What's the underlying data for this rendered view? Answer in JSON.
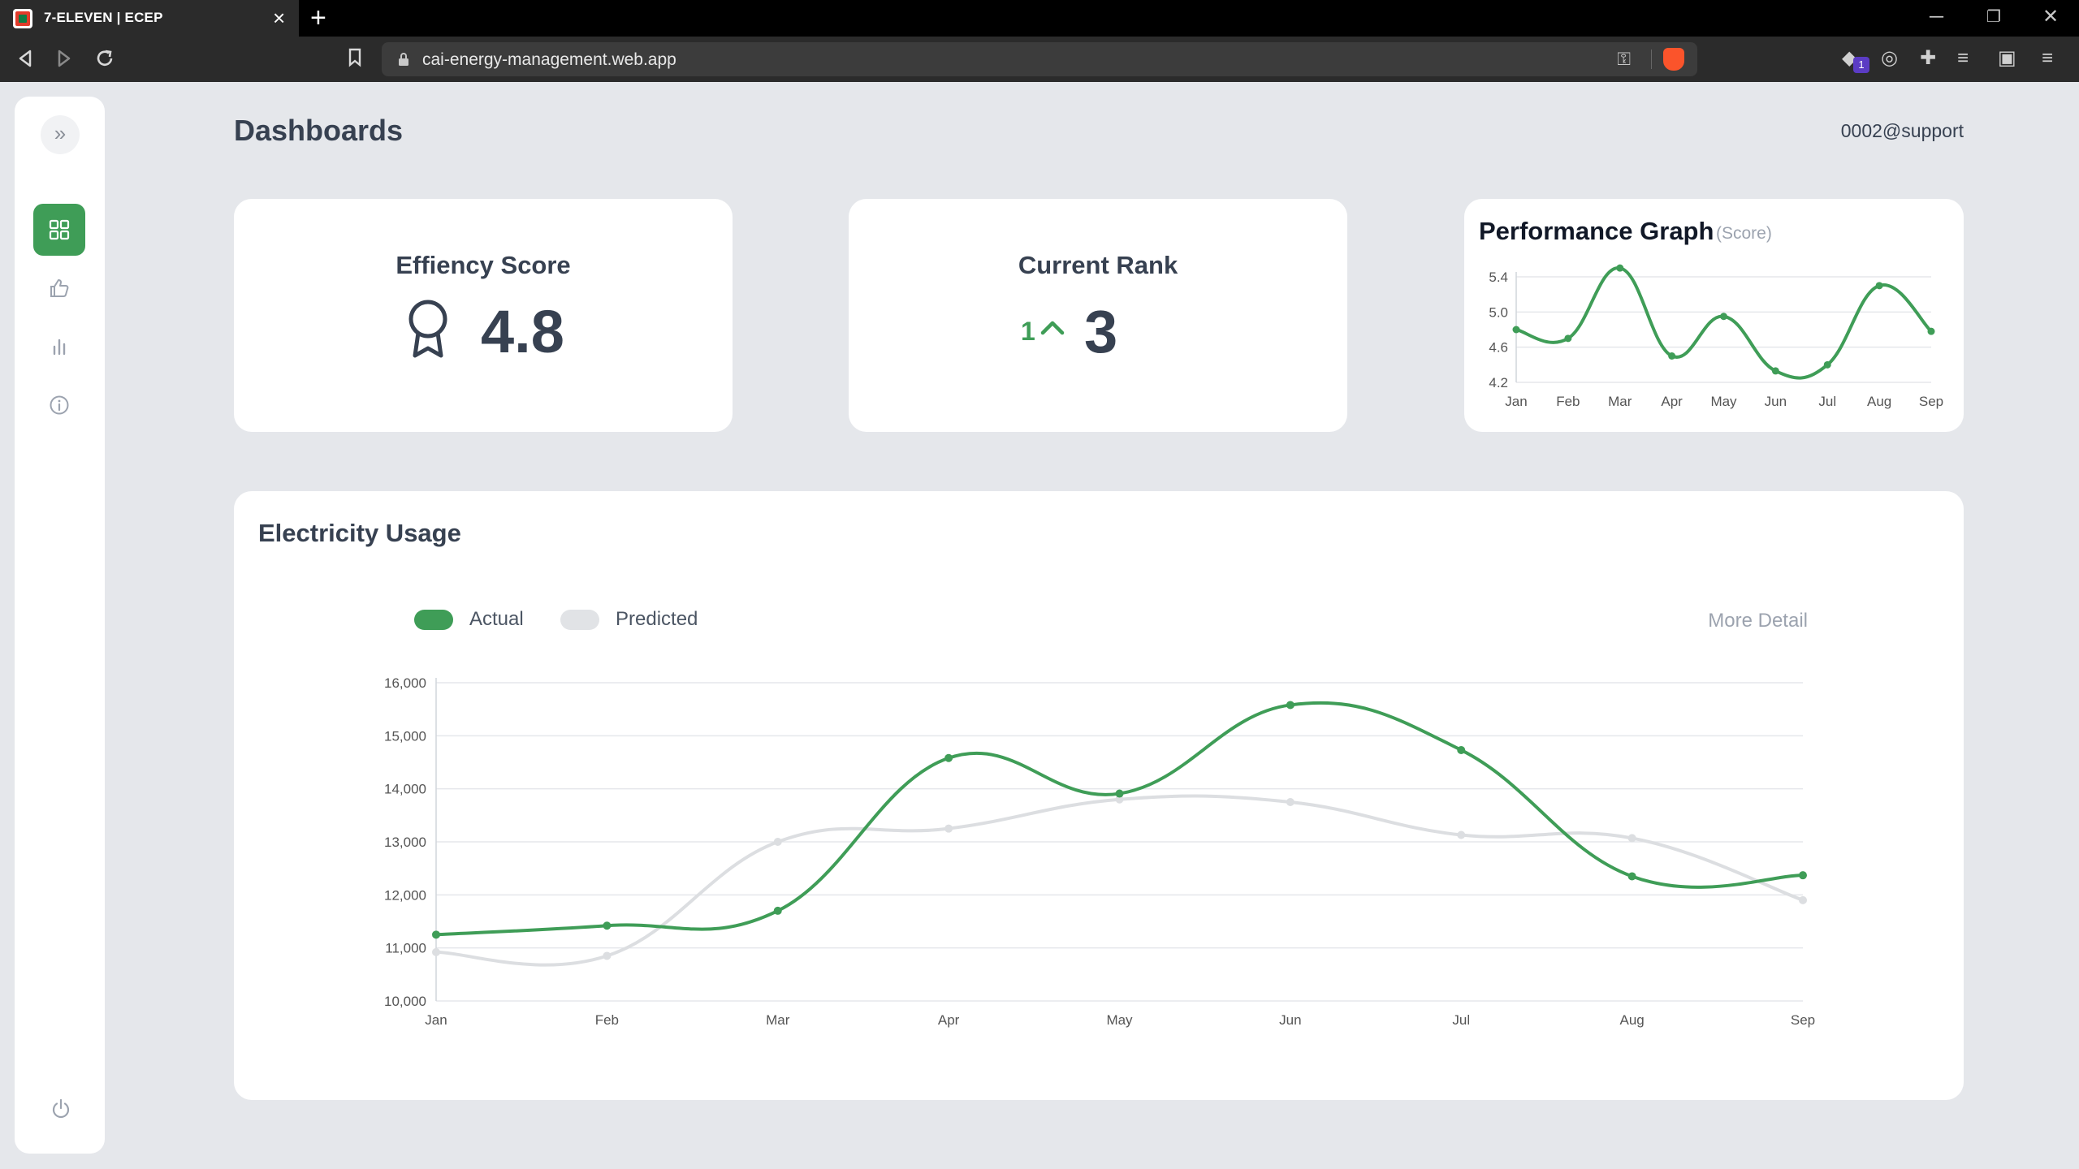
{
  "browser": {
    "tab_title": "7-ELEVEN | ECEP",
    "url": "cai-energy-management.web.app",
    "extension_badge": "1"
  },
  "sidebar": {
    "items": [
      {
        "icon": "dashboard-grid-icon",
        "active": true
      },
      {
        "icon": "thumbs-up-icon",
        "active": false
      },
      {
        "icon": "bar-chart-icon",
        "active": false
      },
      {
        "icon": "info-icon",
        "active": false
      }
    ],
    "accent": "#3f9d57"
  },
  "header": {
    "title": "Dashboards",
    "user": "0002@support"
  },
  "efficiency": {
    "title": "Effiency Score",
    "value": "4.8",
    "icon": "award-ribbon-icon"
  },
  "rank": {
    "title": "Current Rank",
    "delta": "1",
    "value": "3",
    "icon": "chevron-up-icon"
  },
  "performance": {
    "title": "Performance Graph",
    "unit": "(Score)"
  },
  "electricity": {
    "title": "Electricity Usage",
    "more_detail": "More Detail",
    "legend": [
      {
        "label": "Actual",
        "color": "#3f9d57"
      },
      {
        "label": "Predicted",
        "color": "#e1e3e6"
      }
    ]
  },
  "chart_data": [
    {
      "id": "performance",
      "type": "line",
      "title": "Performance Graph",
      "ylabel": "",
      "categories": [
        "Jan",
        "Feb",
        "Mar",
        "Apr",
        "May",
        "Jun",
        "Jul",
        "Aug",
        "Sep"
      ],
      "series": [
        {
          "values": [
            4.8,
            4.7,
            5.5,
            4.5,
            4.95,
            4.33,
            4.4,
            5.3,
            4.78
          ],
          "color": "#3f9d57"
        }
      ],
      "yticks": [
        "5.4",
        "5.0",
        "4.6",
        "4.2"
      ],
      "ylim": [
        4.2,
        5.4
      ],
      "grid": true
    },
    {
      "id": "electricity",
      "type": "line",
      "title": "Electricity Usage",
      "categories": [
        "Jan",
        "Feb",
        "Mar",
        "Apr",
        "May",
        "Jun",
        "Jul",
        "Aug",
        "Sep"
      ],
      "series": [
        {
          "name": "Actual",
          "values": [
            11250,
            11420,
            11700,
            14580,
            13910,
            15580,
            14730,
            12350,
            12370
          ],
          "color": "#3f9d57"
        },
        {
          "name": "Predicted",
          "values": [
            10920,
            10850,
            13000,
            13250,
            13800,
            13750,
            13130,
            13070,
            11900
          ],
          "color": "#dcdee1"
        }
      ],
      "yticks": [
        "16,000",
        "15,000",
        "14,000",
        "13,000",
        "12,000",
        "11,000",
        "10,000"
      ],
      "ylim": [
        10000,
        16000
      ],
      "grid": true,
      "legend": "top-left"
    }
  ]
}
